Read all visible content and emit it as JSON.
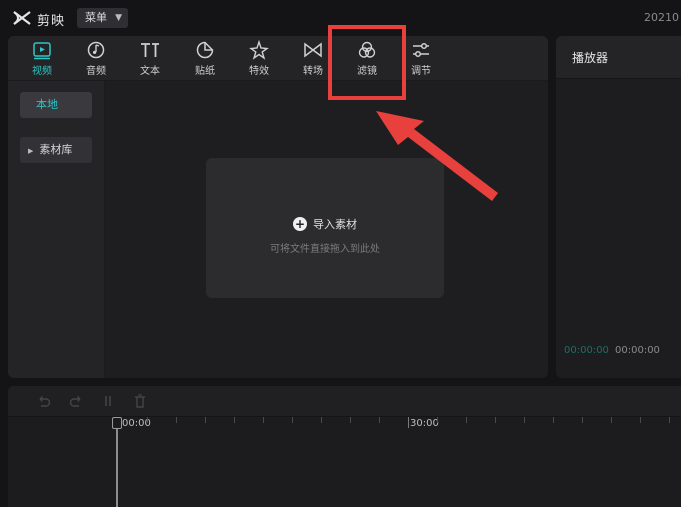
{
  "app": {
    "name": "剪映",
    "menu_label": "菜单",
    "date_text": "20210"
  },
  "toolbar": {
    "tabs": [
      {
        "key": "video",
        "label": "视频",
        "icon": "video-play-icon",
        "active": true
      },
      {
        "key": "audio",
        "label": "音频",
        "icon": "music-note-icon"
      },
      {
        "key": "text",
        "label": "文本",
        "icon": "text-ti-icon"
      },
      {
        "key": "sticker",
        "label": "贴纸",
        "icon": "sticker-icon"
      },
      {
        "key": "effects",
        "label": "特效",
        "icon": "sparkle-star-icon"
      },
      {
        "key": "transition",
        "label": "转场",
        "icon": "transition-bowtie-icon"
      },
      {
        "key": "filter",
        "label": "滤镜",
        "icon": "filter-circles-icon"
      },
      {
        "key": "adjust",
        "label": "调节",
        "icon": "sliders-icon"
      }
    ]
  },
  "sidebar": {
    "local_label": "本地",
    "library_label": "素材库"
  },
  "dropzone": {
    "import_label": "导入素材",
    "hint": "可将文件直接拖入到此处"
  },
  "player": {
    "title": "播放器",
    "current_time": "00:00:00",
    "total_time": "00:00:00"
  },
  "timeline": {
    "ruler_labels": [
      "00:00",
      "30:00"
    ]
  },
  "colors": {
    "accent": "#2bc6c6",
    "annotation": "#e8403d",
    "background": "#141416",
    "panel": "#242427"
  }
}
